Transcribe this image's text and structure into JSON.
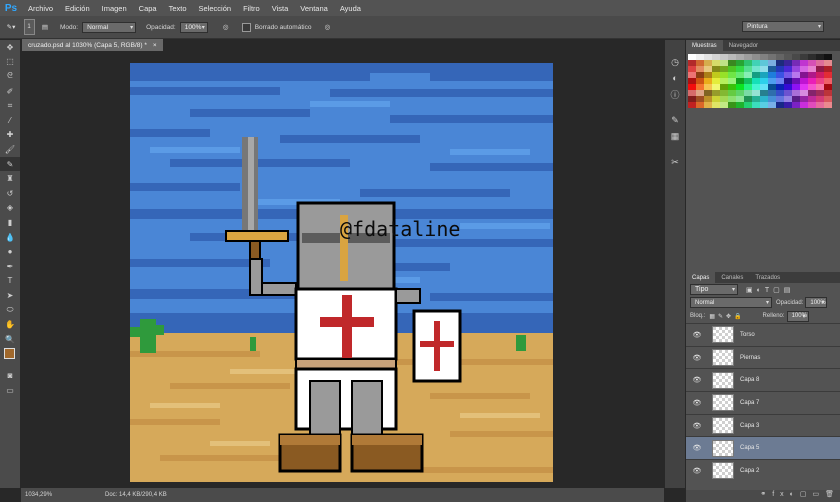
{
  "app": {
    "logo": "Ps"
  },
  "menu": [
    "Archivo",
    "Edición",
    "Imagen",
    "Capa",
    "Texto",
    "Selección",
    "Filtro",
    "Vista",
    "Ventana",
    "Ayuda"
  ],
  "options": {
    "brush_size": "1",
    "mode_label": "Modo:",
    "mode_value": "Normal",
    "opacity_label": "Opacidad:",
    "opacity_value": "100%",
    "auto_erase_label": "Borrado automático",
    "workspace": "Pintura"
  },
  "document": {
    "tab_title": "cruzado.psd al 1030% (Capa 5, RGB/8) *",
    "watermark": "@fdataline"
  },
  "tools": [
    "move-tool-icon",
    "marquee-tool-icon",
    "lasso-tool-icon",
    "quick-select-icon",
    "crop-tool-icon",
    "eyedropper-icon",
    "healing-brush-icon",
    "brush-tool-icon",
    "pencil-tool-icon",
    "stamp-tool-icon",
    "history-brush-icon",
    "eraser-tool-icon",
    "gradient-tool-icon",
    "blur-tool-icon",
    "dodge-tool-icon",
    "pen-tool-icon",
    "type-tool-icon",
    "path-select-icon",
    "shape-tool-icon",
    "hand-tool-icon",
    "zoom-tool-icon"
  ],
  "swatch_panel": {
    "tabs": [
      "Muestras",
      "Navegador"
    ]
  },
  "layers_panel": {
    "tabs": [
      "Capas",
      "Canales",
      "Trazados"
    ],
    "filter": "Tipo",
    "blend_mode": "Normal",
    "opacity_label": "Opacidad:",
    "opacity_value": "100%",
    "lock_label": "Bloq.:",
    "fill_label": "Relleno:",
    "fill_value": "100%",
    "layers": [
      {
        "name": "Torso",
        "selected": false
      },
      {
        "name": "Piernas",
        "selected": false
      },
      {
        "name": "Capa 8",
        "selected": false
      },
      {
        "name": "Capa 7",
        "selected": false
      },
      {
        "name": "Capa 3",
        "selected": false
      },
      {
        "name": "Capa 5",
        "selected": true
      },
      {
        "name": "Capa 2",
        "selected": false
      }
    ]
  },
  "status": {
    "zoom": "1034,29%",
    "doc": "Doc: 14,4 KB/290,4 KB"
  },
  "colors": {
    "foreground": "#a0682c",
    "background": "#ffffff",
    "sky": "#4a86d6",
    "sand": "#d6a95a",
    "selected_layer": "#6c7b93"
  }
}
